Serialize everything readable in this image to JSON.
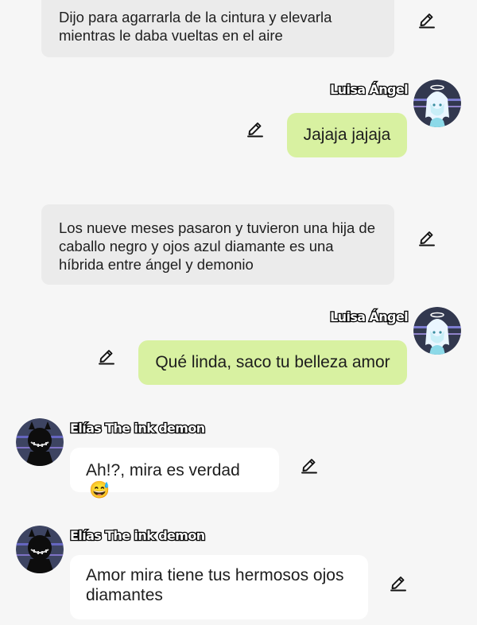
{
  "messages": [
    {
      "type": "narration",
      "text": "Dijo para agarrarla de la cintura y elevarla mientras le daba vueltas en el aire"
    },
    {
      "type": "outgoing",
      "sender": "Luisa Ángel",
      "text": "Jajaja jajaja"
    },
    {
      "type": "narration",
      "text": "Los nueve meses pasaron y tuvieron una hija de caballo negro y ojos azul diamante es una híbrida entre ángel y demonio"
    },
    {
      "type": "outgoing",
      "sender": "Luisa Ángel",
      "text": "Qué linda, saco tu belleza amor"
    },
    {
      "type": "incoming",
      "sender": "Elías The ink demon",
      "text": "Ah!?, mira es verdad",
      "emoji": "😅"
    },
    {
      "type": "incoming",
      "sender": "Elías The ink demon",
      "text": "Amor mira tiene tus hermosos ojos diamantes"
    }
  ],
  "colors": {
    "background": "#f6f6f6",
    "narration_bubble": "#ebebeb",
    "outgoing_bubble": "#d8f1a1",
    "incoming_bubble": "#ffffff"
  },
  "icons": {
    "edit": "pencil-edit-icon",
    "avatar_luisa": "angel-avatar",
    "avatar_elias": "ink-demon-avatar"
  }
}
